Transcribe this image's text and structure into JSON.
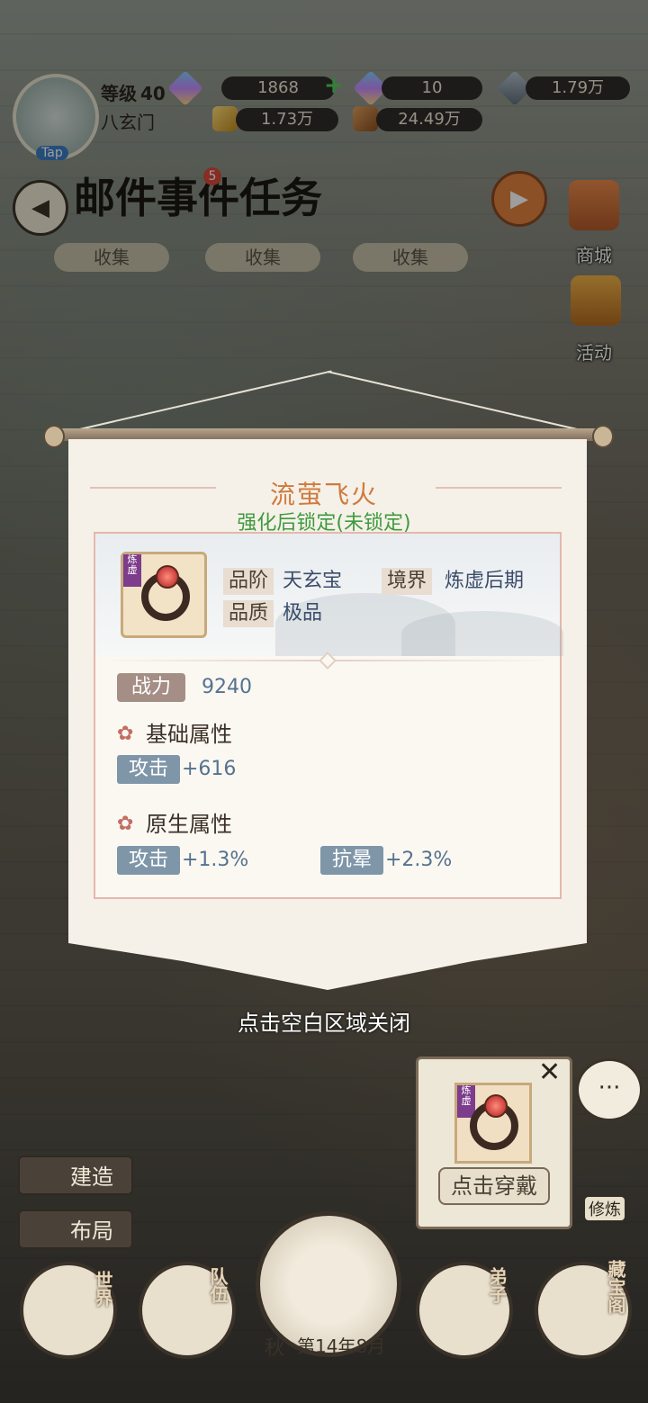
{
  "header": {
    "level_label": "等级",
    "level_value": "40",
    "sect_name": "八玄门",
    "tap_label": "Tap"
  },
  "resources": {
    "r1": "1868",
    "r2": "10",
    "r3": "1.79万",
    "r4": "1.73万",
    "r5": "24.49万"
  },
  "menu": {
    "mail": "邮件",
    "events": "事件",
    "events_badge": "5",
    "tasks": "任务"
  },
  "collect_labels": [
    "收集",
    "收集",
    "收集"
  ],
  "side": {
    "shop": "商城",
    "activity": "活动"
  },
  "modal": {
    "title": "流萤飞火",
    "lock_status": "强化后锁定(未锁定)",
    "item_tag": "炼虚",
    "grade_label": "品阶",
    "grade_value": "天玄宝",
    "realm_label": "境界",
    "realm_value": "炼虚后期",
    "quality_label": "品质",
    "quality_value": "极品",
    "power_label": "战力",
    "power_value": "9240",
    "base_attr_title": "基础属性",
    "base_attrs": [
      {
        "name": "攻击",
        "value": "+616"
      }
    ],
    "native_attr_title": "原生属性",
    "native_attrs": [
      {
        "name": "攻击",
        "value": "+1.3%"
      },
      {
        "name": "抗晕",
        "value": "+2.3%"
      }
    ],
    "close_hint": "点击空白区域关闭"
  },
  "equip_popup": {
    "tag": "炼虚",
    "button": "点击穿戴",
    "close": "✕"
  },
  "bottom": {
    "build": "建造",
    "layout": "布局",
    "world": "世界",
    "team": "队伍",
    "disciples": "弟子",
    "treasure": "藏宝阁",
    "season": "秋",
    "date": "第14年8月",
    "cultivate": "修炼"
  }
}
